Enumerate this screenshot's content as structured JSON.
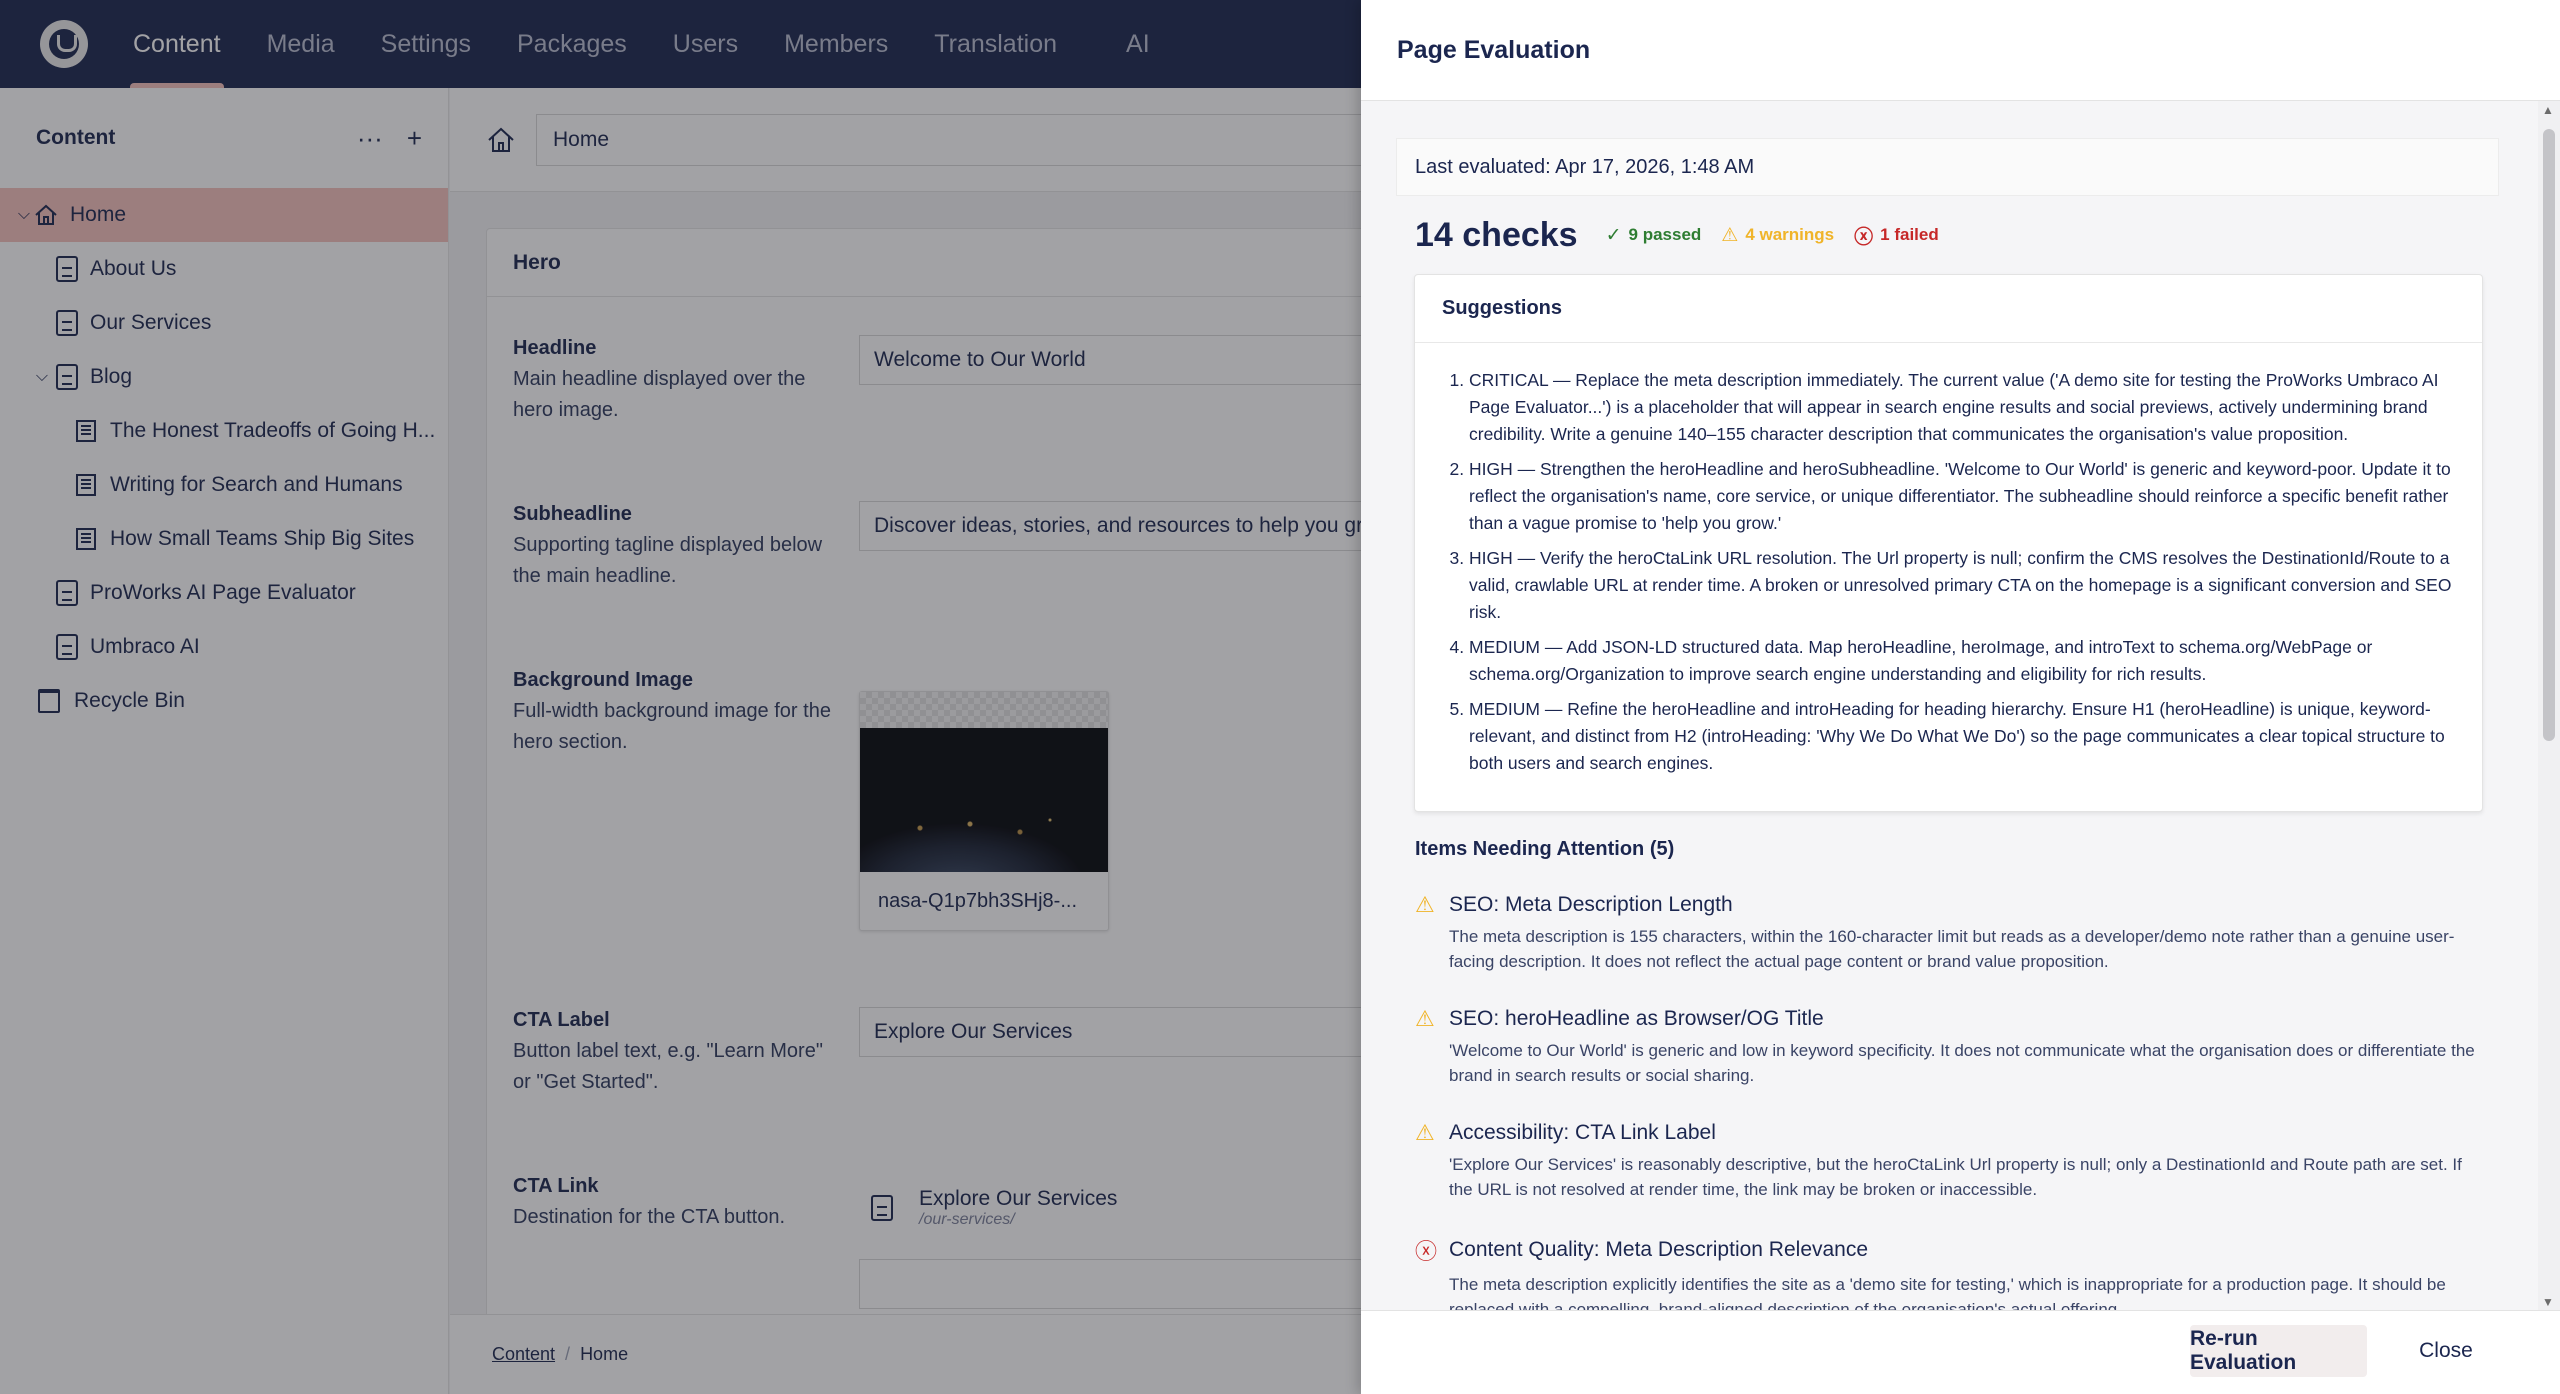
{
  "colors": {
    "header_bg": "#1b264f",
    "selected_bg": "#f5c1bc",
    "passed": "#2e7d32",
    "warning": "#f0b429",
    "failed": "#c62828"
  },
  "nav": {
    "items": [
      {
        "label": "Content",
        "active": true
      },
      {
        "label": "Media"
      },
      {
        "label": "Settings"
      },
      {
        "label": "Packages"
      },
      {
        "label": "Users"
      },
      {
        "label": "Members"
      },
      {
        "label": "Translation"
      },
      {
        "label": "AI"
      }
    ]
  },
  "sidebar": {
    "title": "Content",
    "items": [
      {
        "label": "Home",
        "icon": "home-icon",
        "expanded": true,
        "selected": true
      },
      {
        "label": "About Us",
        "icon": "document-icon"
      },
      {
        "label": "Our Services",
        "icon": "document-icon"
      },
      {
        "label": "Blog",
        "icon": "document-icon",
        "expanded": true
      },
      {
        "label": "The Honest Tradeoffs of Going H...",
        "icon": "article-icon"
      },
      {
        "label": "Writing for Search and Humans",
        "icon": "article-icon"
      },
      {
        "label": "How Small Teams Ship Big Sites",
        "icon": "article-icon"
      },
      {
        "label": "ProWorks AI Page Evaluator",
        "icon": "document-icon"
      },
      {
        "label": "Umbraco AI",
        "icon": "document-icon"
      },
      {
        "label": "Recycle Bin",
        "icon": "trash-icon"
      }
    ]
  },
  "editor": {
    "node_name": "Home",
    "group_title": "Hero",
    "properties": {
      "headline": {
        "label": "Headline",
        "description": "Main headline displayed over the hero image.",
        "value": "Welcome to Our World"
      },
      "subheadline": {
        "label": "Subheadline",
        "description": "Supporting tagline displayed below the main headline.",
        "value": "Discover ideas, stories, and resources to help you grow."
      },
      "background": {
        "label": "Background Image",
        "description": "Full-width background image for the hero section.",
        "media_name": "nasa-Q1p7bh3SHj8-..."
      },
      "cta_label": {
        "label": "CTA Label",
        "description": "Button label text, e.g. \"Learn More\" or \"Get Started\".",
        "value": "Explore Our Services"
      },
      "cta_link": {
        "label": "CTA Link",
        "description": "Destination for the CTA button.",
        "link_name": "Explore Our Services",
        "link_url": "/our-services/"
      }
    },
    "breadcrumb": {
      "root": "Content",
      "current": "Home"
    }
  },
  "panel": {
    "title": "Page Evaluation",
    "last_evaluated": "Last evaluated: Apr 17, 2026, 1:48 AM",
    "checks_total": "14 checks",
    "passed": "9 passed",
    "warnings": "4 warnings",
    "failed": "1 failed",
    "suggestions_title": "Suggestions",
    "suggestions": [
      "CRITICAL — Replace the meta description immediately. The current value ('A demo site for testing the ProWorks Umbraco AI Page Evaluator...') is a placeholder that will appear in search engine results and social previews, actively undermining brand credibility. Write a genuine 140–155 character description that communicates the organisation's value proposition.",
      "HIGH — Strengthen the heroHeadline and heroSubheadline. 'Welcome to Our World' is generic and keyword-poor. Update it to reflect the organisation's name, core service, or unique differentiator. The subheadline should reinforce a specific benefit rather than a vague promise to 'help you grow.'",
      "HIGH — Verify the heroCtaLink URL resolution. The Url property is null; confirm the CMS resolves the DestinationId/Route to a valid, crawlable URL at render time. A broken or unresolved primary CTA on the homepage is a significant conversion and SEO risk.",
      "MEDIUM — Add JSON-LD structured data. Map heroHeadline, heroImage, and introText to schema.org/WebPage or schema.org/Organization to improve search engine understanding and eligibility for rich results.",
      "MEDIUM — Refine the heroHeadline and introHeading for heading hierarchy. Ensure H1 (heroHeadline) is unique, keyword-relevant, and distinct from H2 (introHeading: 'Why We Do What We Do') so the page communicates a clear topical structure to both users and search engines."
    ],
    "attention_title": "Items Needing Attention (5)",
    "attention_items": [
      {
        "status": "warning",
        "title": "SEO: Meta Description Length",
        "description": "The meta description is 155 characters, within the 160-character limit but reads as a developer/demo note rather than a genuine user-facing description. It does not reflect the actual page content or brand value proposition."
      },
      {
        "status": "warning",
        "title": "SEO: heroHeadline as Browser/OG Title",
        "description": "'Welcome to Our World' is generic and low in keyword specificity. It does not communicate what the organisation does or differentiate the brand in search results or social sharing."
      },
      {
        "status": "warning",
        "title": "Accessibility: CTA Link Label",
        "description": "'Explore Our Services' is reasonably descriptive, but the heroCtaLink Url property is null; only a DestinationId and Route path are set. If the URL is not resolved at render time, the link may be broken or inaccessible."
      },
      {
        "status": "failed",
        "title": "Content Quality: Meta Description Relevance",
        "description": "The meta description explicitly identifies the site as a 'demo site for testing,' which is inappropriate for a production page. It should be replaced with a compelling, brand-aligned description of the organisation's actual offering."
      }
    ],
    "rerun_label": "Re-run Evaluation",
    "close_label": "Close"
  }
}
